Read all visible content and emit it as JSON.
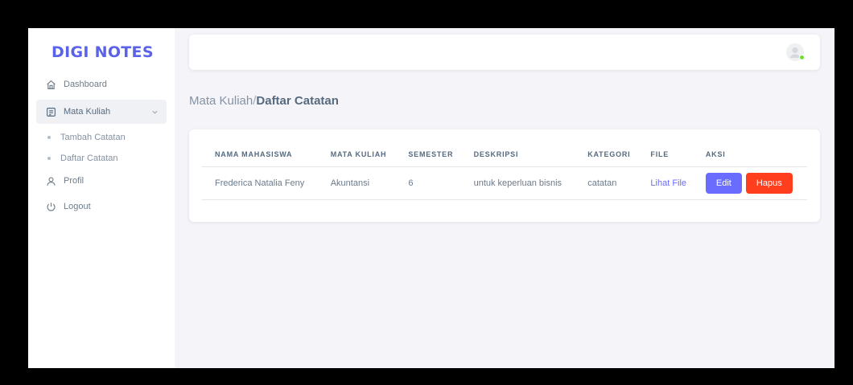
{
  "brand": "DIGI NOTES",
  "sidebar": {
    "items": [
      {
        "label": "Dashboard",
        "icon": "home-icon"
      },
      {
        "label": "Mata Kuliah",
        "icon": "notes-icon",
        "expanded": true
      },
      {
        "label": "Tambah Catatan",
        "sub": true
      },
      {
        "label": "Daftar Catatan",
        "sub": true
      },
      {
        "label": "Profil",
        "icon": "user-icon"
      },
      {
        "label": "Logout",
        "icon": "power-icon"
      }
    ]
  },
  "breadcrumb": {
    "parent": "Mata Kuliah",
    "separator": "/",
    "current": "Daftar Catatan"
  },
  "table": {
    "headers": [
      "NAMA MAHASISWA",
      "MATA KULIAH",
      "SEMESTER",
      "DESKRIPSI",
      "KATEGORI",
      "FILE",
      "AKSI"
    ],
    "rows": [
      {
        "nama": "Frederica Natalia Feny",
        "mata_kuliah": "Akuntansi",
        "semester": "6",
        "deskripsi": "untuk keperluan bisnis",
        "kategori": "catatan",
        "file": "Lihat File",
        "edit": "Edit",
        "hapus": "Hapus"
      }
    ]
  },
  "colors": {
    "accent": "#696cff",
    "brand": "#5a63e8",
    "danger": "#ff3e1d",
    "online": "#71dd37"
  }
}
